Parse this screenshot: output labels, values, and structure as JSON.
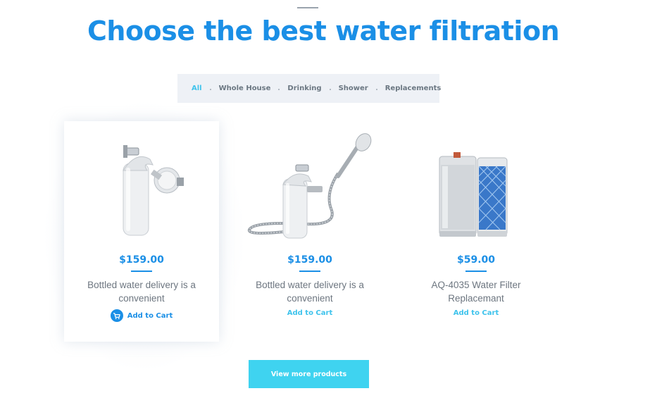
{
  "section": {
    "heading": "Choose the best water filtration"
  },
  "filters": {
    "items": [
      {
        "label": "All",
        "active": true
      },
      {
        "label": "Whole House",
        "active": false
      },
      {
        "label": "Drinking",
        "active": false
      },
      {
        "label": "Shower",
        "active": false
      },
      {
        "label": "Replacements",
        "active": false
      }
    ]
  },
  "products": [
    {
      "image": "shower-head-filter",
      "price": "$159.00",
      "description": "Bottled water delivery is a convenient",
      "cart_label": "Add to Cart",
      "cart_icon": "cart-icon"
    },
    {
      "image": "handheld-shower-filter",
      "price": "$159.00",
      "description": "Bottled water delivery is a convenient",
      "cart_label": "Add to Cart"
    },
    {
      "image": "replacement-cartridges",
      "price": "$59.00",
      "description": "AQ-4035 Water Filter Replacemant",
      "cart_label": "Add to Cart"
    }
  ],
  "view_more": {
    "label": "View more products"
  },
  "colors": {
    "primary": "#1b8fe6",
    "accent": "#3fc3ec",
    "button": "#3fd3f0",
    "text_muted": "#6d7680",
    "filter_bg": "#eef1f6"
  }
}
